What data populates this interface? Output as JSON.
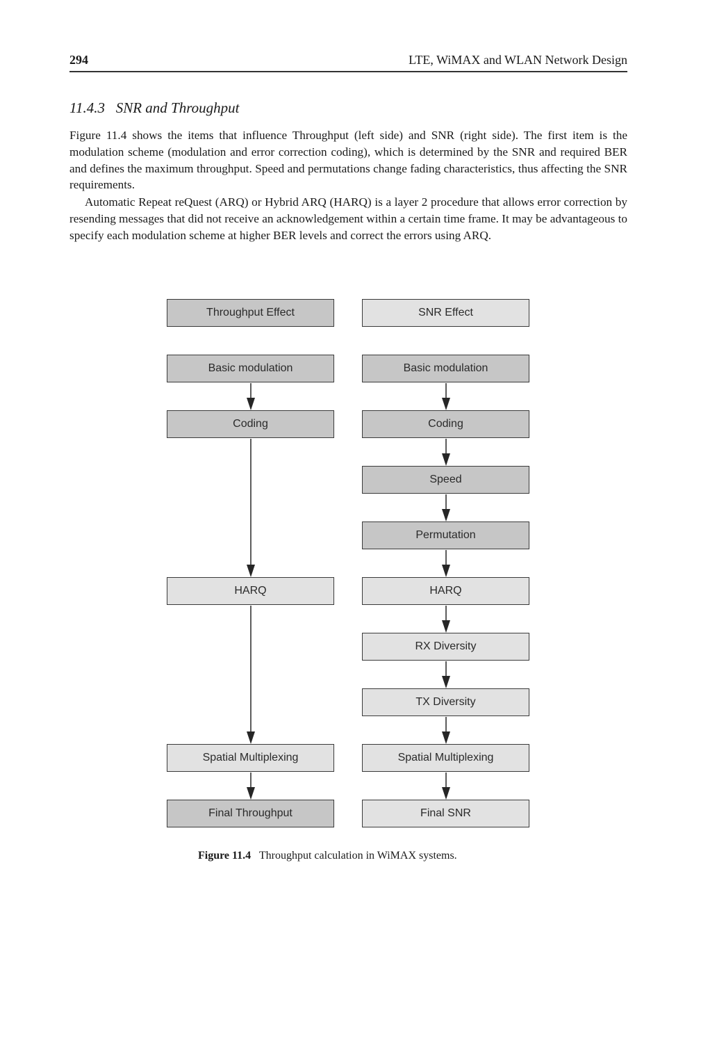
{
  "header": {
    "page_number": "294",
    "running_title": "LTE, WiMAX and WLAN Network Design"
  },
  "section": {
    "number": "11.4.3",
    "title": "SNR and Throughput"
  },
  "paragraphs": [
    "Figure 11.4 shows the items that influence Throughput (left side) and SNR (right side). The first item is the modulation scheme (modulation and error correction coding), which is determined by the SNR and required BER and defines the maximum throughput. Speed and permutations change fading characteristics, thus affecting the SNR requirements.",
    "Automatic Repeat reQuest (ARQ) or Hybrid ARQ (HARQ) is a layer 2 procedure that allows error correction by resending messages that did not receive an acknowledgement within a certain time frame. It may be advantageous to specify each modulation scheme at higher BER levels and correct the errors using ARQ."
  ],
  "figure": {
    "colors": {
      "dark_box": "#c6c6c6",
      "light_box": "#e2e2e2",
      "border": "#3a3a3a",
      "arrow": "#262626"
    },
    "left_column": {
      "header": {
        "label": "Throughput Effect",
        "shade": "dark"
      },
      "nodes": [
        {
          "label": "Basic modulation",
          "shade": "dark"
        },
        {
          "label": "Coding",
          "shade": "dark"
        },
        {
          "label": "HARQ",
          "shade": "light"
        },
        {
          "label": "Spatial Multiplexing",
          "shade": "light"
        },
        {
          "label": "Final Throughput",
          "shade": "dark"
        }
      ]
    },
    "right_column": {
      "header": {
        "label": "SNR Effect",
        "shade": "light"
      },
      "nodes": [
        {
          "label": "Basic modulation",
          "shade": "dark"
        },
        {
          "label": "Coding",
          "shade": "dark"
        },
        {
          "label": "Speed",
          "shade": "dark"
        },
        {
          "label": "Permutation",
          "shade": "dark"
        },
        {
          "label": "HARQ",
          "shade": "light"
        },
        {
          "label": "RX Diversity",
          "shade": "light"
        },
        {
          "label": "TX Diversity",
          "shade": "light"
        },
        {
          "label": "Spatial Multiplexing",
          "shade": "light"
        },
        {
          "label": "Final SNR",
          "shade": "light"
        }
      ]
    },
    "edges": [
      {
        "from": "left.Basic modulation",
        "to": "left.Coding"
      },
      {
        "from": "left.Coding",
        "to": "left.HARQ"
      },
      {
        "from": "left.HARQ",
        "to": "left.Spatial Multiplexing"
      },
      {
        "from": "left.Spatial Multiplexing",
        "to": "left.Final Throughput"
      },
      {
        "from": "right.Basic modulation",
        "to": "right.Coding"
      },
      {
        "from": "right.Coding",
        "to": "right.Speed"
      },
      {
        "from": "right.Speed",
        "to": "right.Permutation"
      },
      {
        "from": "right.Permutation",
        "to": "right.HARQ"
      },
      {
        "from": "right.HARQ",
        "to": "right.RX Diversity"
      },
      {
        "from": "right.RX Diversity",
        "to": "right.TX Diversity"
      },
      {
        "from": "right.TX Diversity",
        "to": "right.Spatial Multiplexing"
      },
      {
        "from": "right.Spatial Multiplexing",
        "to": "right.Final SNR"
      }
    ],
    "caption": {
      "label": "Figure 11.4",
      "text": "Throughput calculation in WiMAX systems."
    }
  }
}
